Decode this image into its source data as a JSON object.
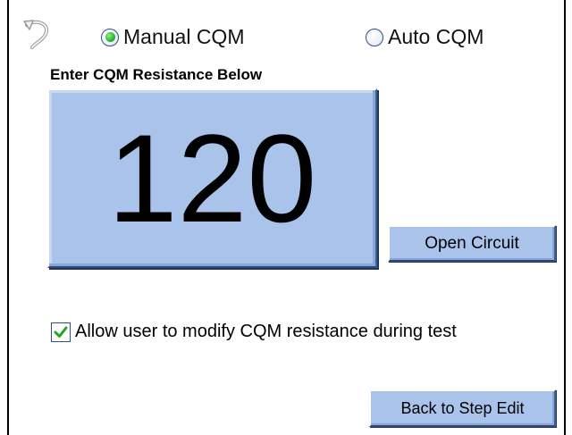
{
  "mode": {
    "options": [
      {
        "label": "Manual CQM",
        "selected": true
      },
      {
        "label": "Auto CQM",
        "selected": false
      }
    ]
  },
  "heading": "Enter CQM Resistance Below",
  "resistance": {
    "value": "120"
  },
  "buttons": {
    "open_circuit": "Open Circuit",
    "back_to_step_edit": "Back to Step Edit"
  },
  "allow_modify": {
    "label": "Allow user to modify CQM resistance during test",
    "checked": true
  },
  "colors": {
    "button_fill": "#aac3ea",
    "radio_selected": "#2fb52f",
    "checkmark": "#1fa81f",
    "control_border": "#2e4f86"
  },
  "icons": {
    "back": "back-arrow-icon",
    "checkmark": "checkmark-icon"
  }
}
